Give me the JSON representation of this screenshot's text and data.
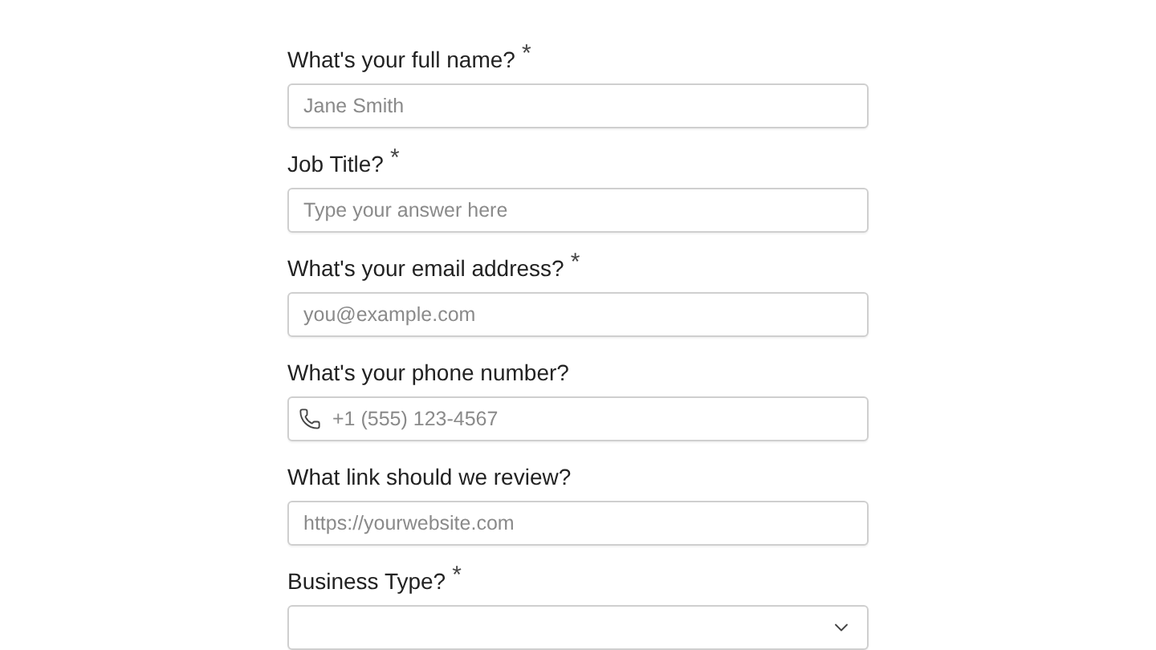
{
  "fields": [
    {
      "kind": "text",
      "label": "What's your full name?",
      "required_mark": "*",
      "placeholder": "Jane Smith"
    },
    {
      "kind": "text",
      "label": "Job Title?",
      "required_mark": "*",
      "placeholder": "Type your answer here"
    },
    {
      "kind": "text",
      "label": "What's your email address?",
      "required_mark": "*",
      "placeholder": "you@example.com"
    },
    {
      "kind": "phone",
      "label": "What's your phone number?",
      "placeholder": "+1 (555) 123-4567"
    },
    {
      "kind": "text",
      "label": "What link should we review?",
      "placeholder": "https://yourwebsite.com"
    },
    {
      "kind": "select",
      "label": "Business Type?",
      "required_mark": "*"
    }
  ]
}
